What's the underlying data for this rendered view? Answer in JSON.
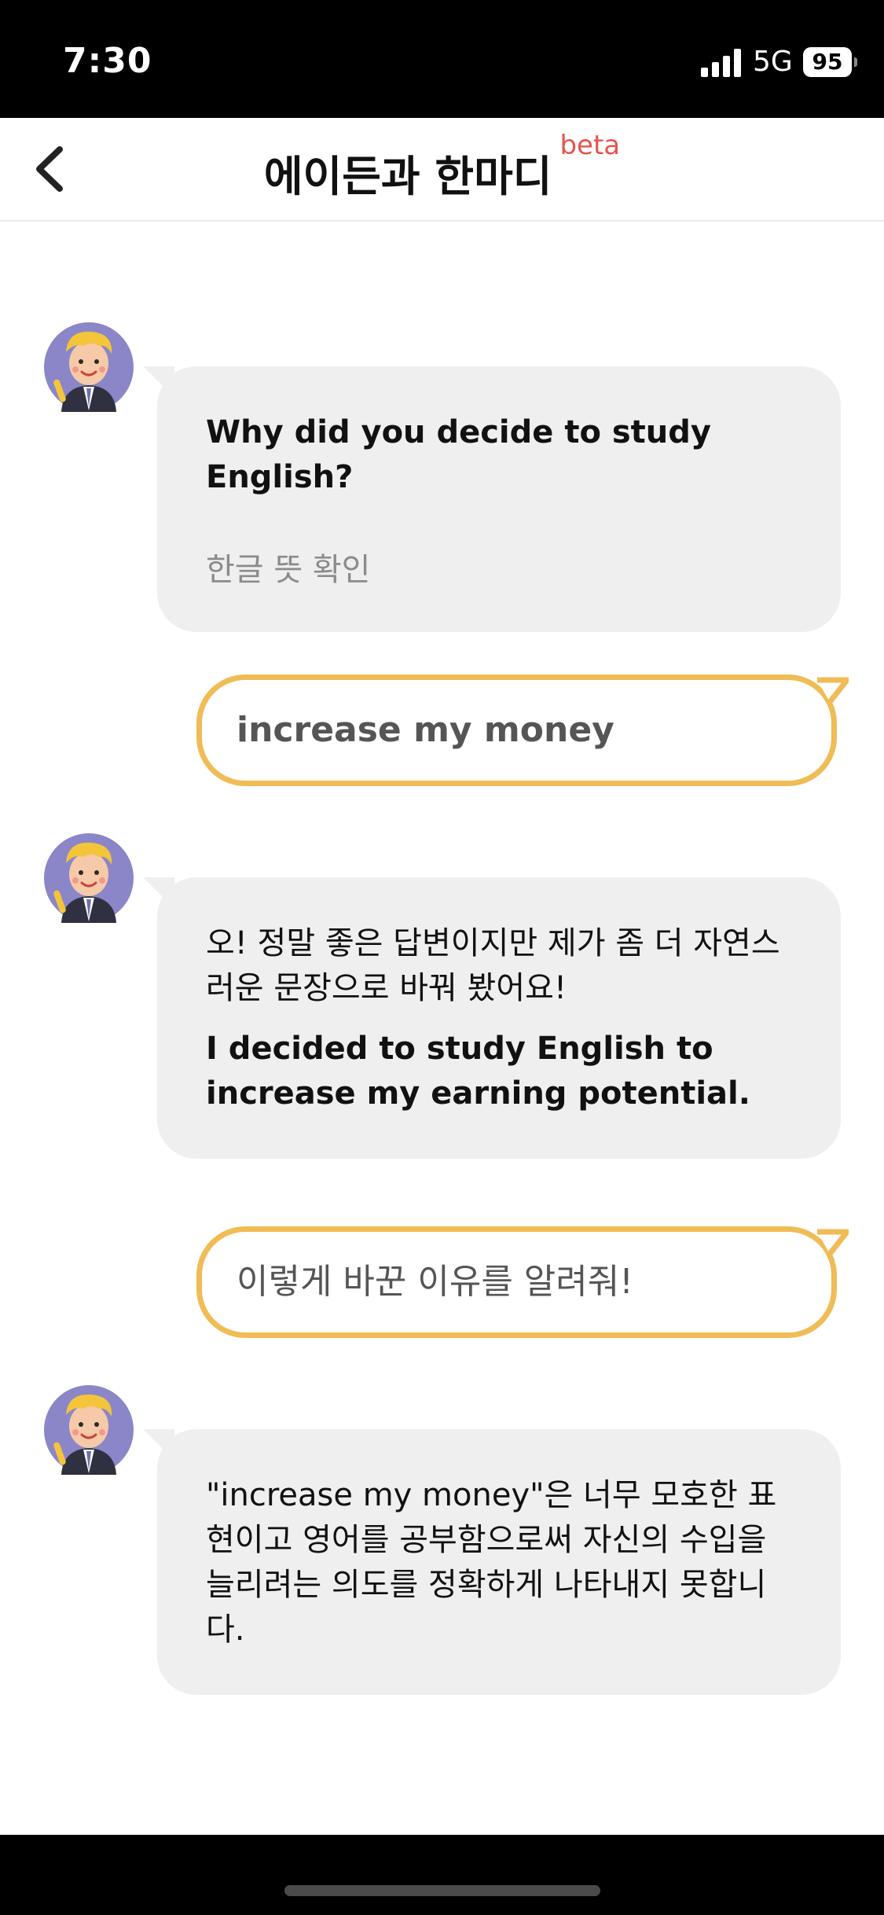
{
  "status_bar": {
    "time": "7:30",
    "network": "5G",
    "battery": "95"
  },
  "header": {
    "title": "에이든과 한마디",
    "badge": "beta",
    "back_icon": "chevron-left-icon"
  },
  "messages": [
    {
      "role": "bot",
      "text": "Why did you decide to study English?",
      "translate_label": "한글 뜻 확인"
    },
    {
      "role": "user",
      "text": "increase my money"
    },
    {
      "role": "bot",
      "text_ko": "오! 정말 좋은 답변이지만 제가 좀 더 자연스러운 문장으로 바꿔 봤어요!",
      "text_en": "I decided to study English to increase my earning potential."
    },
    {
      "role": "user",
      "text": "이렇게 바꾼 이유를 알려줘!"
    },
    {
      "role": "bot",
      "text": "\"increase my money\"은 너무 모호한 표현이고 영어를 공부함으로써 자신의 수입을 늘리려는 의도를 정확하게 나타내지 못합니다."
    }
  ],
  "colors": {
    "bot_bubble": "#efefef",
    "user_bubble_border": "#efbc55",
    "beta_badge": "#e5544e",
    "status_bar_bg": "#000000"
  }
}
